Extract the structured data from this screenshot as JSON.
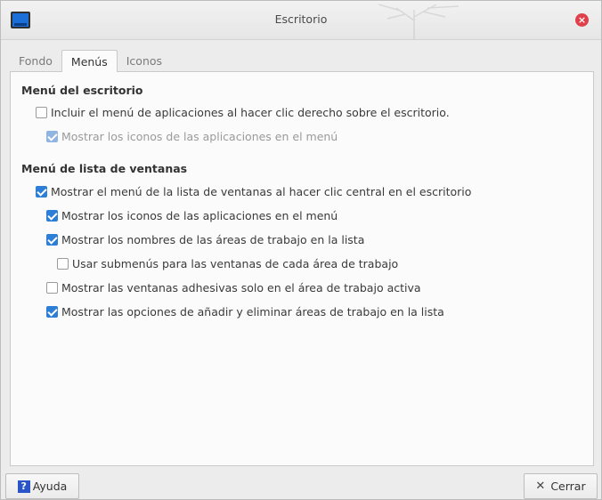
{
  "window": {
    "title": "Escritorio"
  },
  "tabs": [
    {
      "label": "Fondo"
    },
    {
      "label": "Menús"
    },
    {
      "label": "Iconos"
    }
  ],
  "desktop_menu": {
    "title": "Menú del escritorio",
    "options": [
      {
        "label": "Incluir el menú de aplicaciones al hacer clic derecho sobre el escritorio.",
        "checked": false,
        "disabled": false
      },
      {
        "label": "Mostrar los iconos de las aplicaciones en el menú",
        "checked": true,
        "disabled": true
      }
    ]
  },
  "window_list_menu": {
    "title": "Menú de lista de ventanas",
    "options": [
      {
        "label": "Mostrar el menú de la lista de ventanas al hacer clic central en el escritorio",
        "checked": true
      },
      {
        "label": "Mostrar los iconos de las aplicaciones en el menú",
        "checked": true
      },
      {
        "label": "Mostrar los nombres de las áreas de trabajo en la lista",
        "checked": true
      },
      {
        "label": "Usar submenús para las ventanas de cada área de trabajo",
        "checked": false
      },
      {
        "label": "Mostrar las ventanas adhesivas solo en el área de trabajo activa",
        "checked": false
      },
      {
        "label": "Mostrar las opciones de añadir y eliminar áreas de trabajo en la lista",
        "checked": true
      }
    ]
  },
  "buttons": {
    "help": "Ayuda",
    "close": "Cerrar"
  },
  "icons": {
    "help": "?",
    "close": "✕",
    "window_close": "×"
  },
  "colors": {
    "accent": "#2c7ed6",
    "close_red": "#e0404a"
  }
}
